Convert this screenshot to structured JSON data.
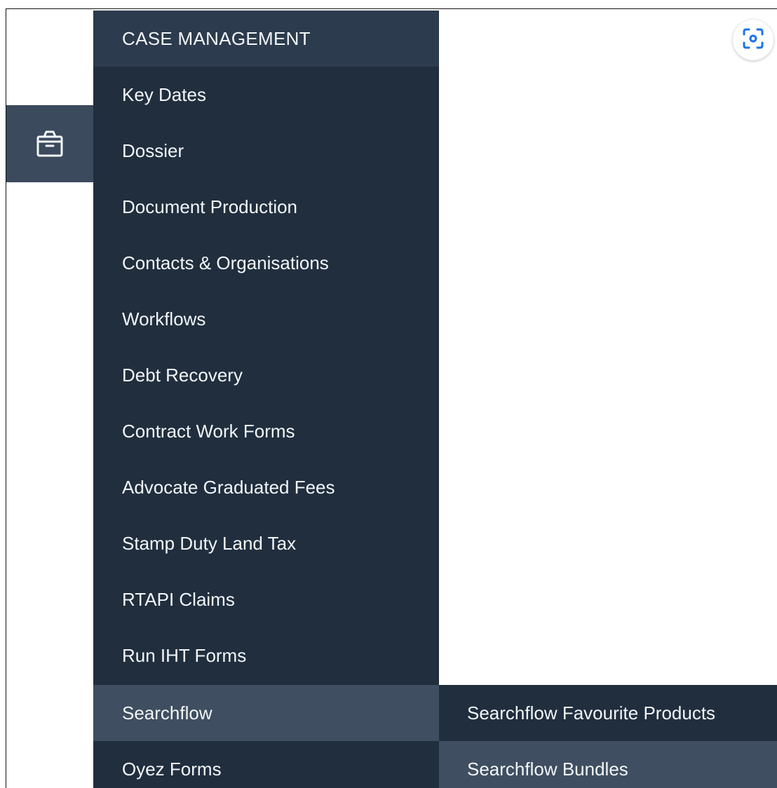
{
  "menu": {
    "header": "CASE MANAGEMENT",
    "items": [
      {
        "label": "Key Dates"
      },
      {
        "label": "Dossier"
      },
      {
        "label": "Document Production"
      },
      {
        "label": "Contacts & Organisations"
      },
      {
        "label": "Workflows"
      },
      {
        "label": "Debt Recovery"
      },
      {
        "label": "Contract Work Forms"
      },
      {
        "label": "Advocate Graduated Fees"
      },
      {
        "label": "Stamp Duty Land Tax"
      },
      {
        "label": "RTAPI Claims"
      },
      {
        "label": "Run IHT Forms"
      },
      {
        "label": "Searchflow",
        "highlighted": true
      },
      {
        "label": "Oyez Forms"
      }
    ]
  },
  "submenu": {
    "items": [
      {
        "label": "Searchflow Favourite Products"
      },
      {
        "label": "Searchflow Bundles",
        "highlighted": true
      }
    ]
  },
  "rail": {
    "active_icon": "case-box-icon"
  },
  "toolbar": {
    "screenshot_icon": "screenshot-capture-icon"
  },
  "colors": {
    "menu_bg": "#202e3e",
    "header_bg": "#2c3b4d",
    "highlight_bg": "#3f4e60",
    "rail_active_bg": "#3b4a5d",
    "text": "#f2f5f8",
    "icon_blue": "#1a73e8"
  }
}
